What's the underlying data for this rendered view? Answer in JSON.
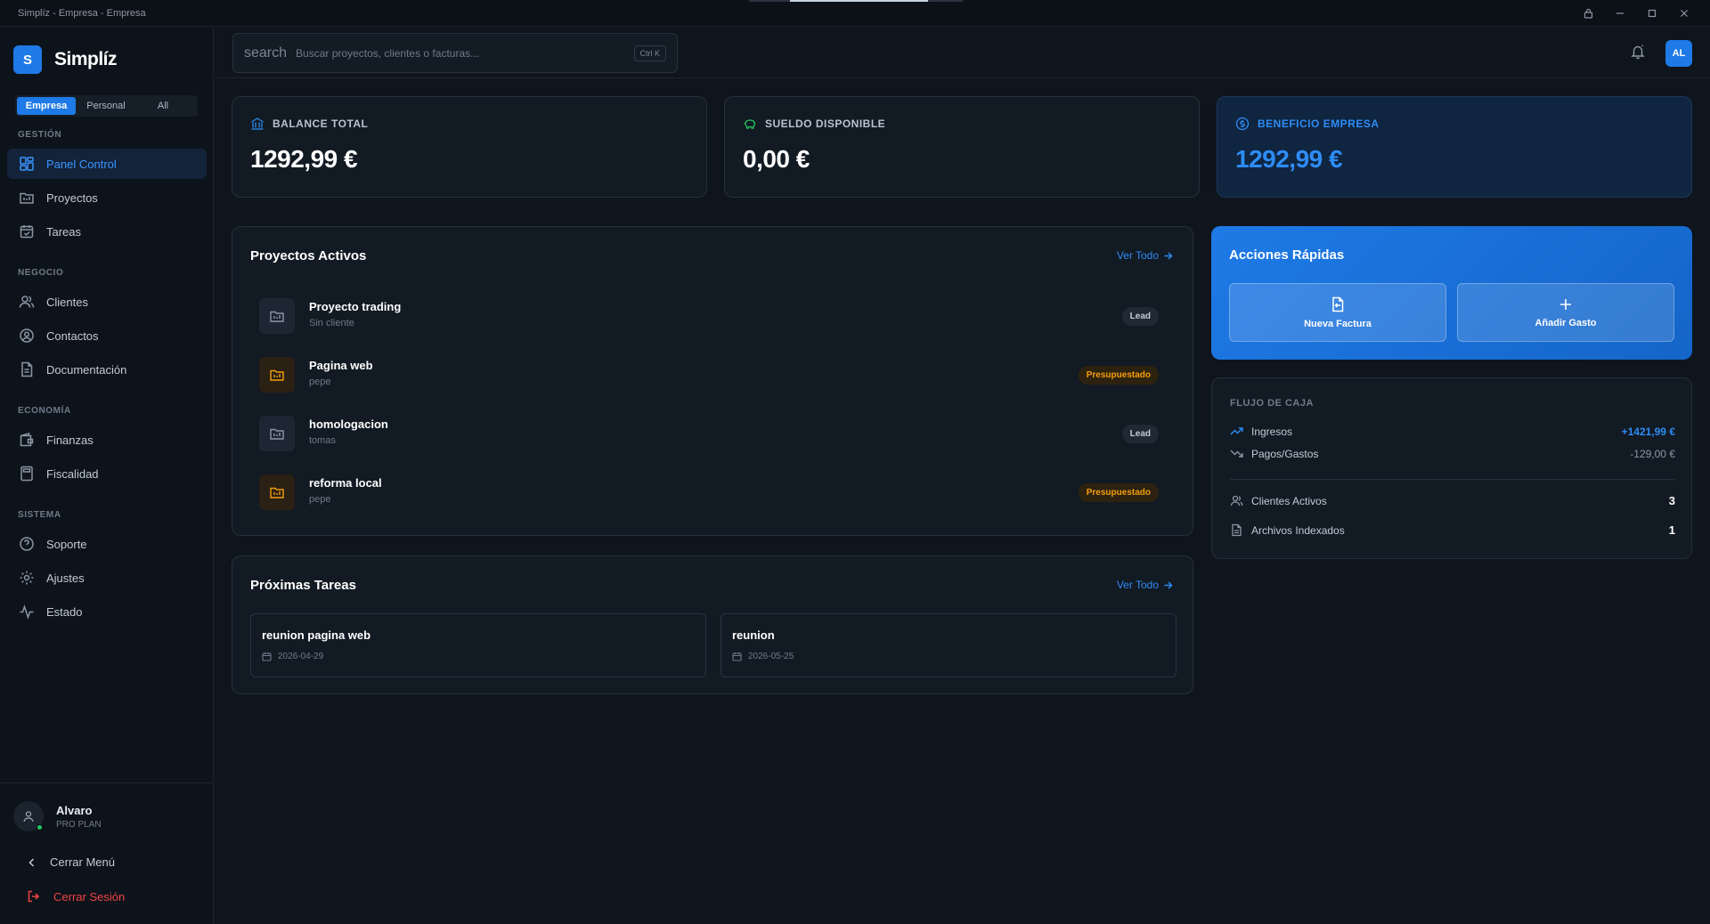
{
  "window": {
    "title": "Simplíz - Empresa - Empresa",
    "load_progress": 0.8
  },
  "brand": {
    "logo_letter": "S",
    "name": "Simplíz"
  },
  "scope_tabs": [
    {
      "label": "Empresa",
      "active": true
    },
    {
      "label": "Personal",
      "active": false
    },
    {
      "label": "All",
      "active": false
    }
  ],
  "sidebar": {
    "sections": {
      "gestion": "GESTIÓN",
      "negocio": "NEGOCIO",
      "economia": "ECONOMÍA",
      "sistema": "SISTEMA"
    },
    "items": {
      "panel": "Panel Control",
      "proyectos": "Proyectos",
      "tareas": "Tareas",
      "clientes": "Clientes",
      "contactos": "Contactos",
      "documentacion": "Documentación",
      "finanzas": "Finanzas",
      "fiscalidad": "Fiscalidad",
      "soporte": "Soporte",
      "ajustes": "Ajustes",
      "estado": "Estado"
    },
    "active_item": "panel"
  },
  "user": {
    "name": "Alvaro",
    "plan": "PRO PLAN",
    "initials": "AL",
    "online": true
  },
  "footer": {
    "close_menu": "Cerrar Menú",
    "logout": "Cerrar Sesión"
  },
  "search": {
    "icon_text": "search",
    "placeholder": "Buscar proyectos, clientes o facturas...",
    "shortcut": "Ctrl K"
  },
  "stats": {
    "balance": {
      "label": "BALANCE TOTAL",
      "value": "1292,99 €"
    },
    "sueldo": {
      "label": "SUELDO DISPONIBLE",
      "value": "0,00 €"
    },
    "beneficio": {
      "label": "BENEFICIO EMPRESA",
      "value": "1292,99 €"
    }
  },
  "projects": {
    "title": "Proyectos Activos",
    "see_all": "Ver Todo",
    "rows": [
      {
        "name": "Proyecto trading",
        "client": "Sin cliente",
        "status": "Lead"
      },
      {
        "name": "Pagina web",
        "client": "pepe",
        "status": "Presupuestado"
      },
      {
        "name": "homologacion",
        "client": "tomas",
        "status": "Lead"
      },
      {
        "name": "reforma local",
        "client": "pepe",
        "status": "Presupuestado"
      }
    ]
  },
  "tasks": {
    "title": "Próximas Tareas",
    "see_all": "Ver Todo",
    "items": [
      {
        "name": "reunion pagina web",
        "date": "2026-04-29"
      },
      {
        "name": "reunion",
        "date": "2026-05-25"
      }
    ]
  },
  "quick_actions": {
    "title": "Acciones Rápidas",
    "new_invoice": "Nueva Factura",
    "add_expense": "Añadir Gasto"
  },
  "cashflow": {
    "title": "FLUJO DE CAJA",
    "income_label": "Ingresos",
    "income_value": "+1421,99 €",
    "expenses_label": "Pagos/Gastos",
    "expenses_value": "-129,00 €",
    "clients_label": "Clientes Activos",
    "clients_value": "3",
    "files_label": "Archivos Indexados",
    "files_value": "1"
  },
  "colors": {
    "accent": "#1e7ae6",
    "accent_text": "#2e8cf5",
    "warning": "#f59e0b",
    "danger": "#ef4444",
    "online": "#22c55e"
  }
}
